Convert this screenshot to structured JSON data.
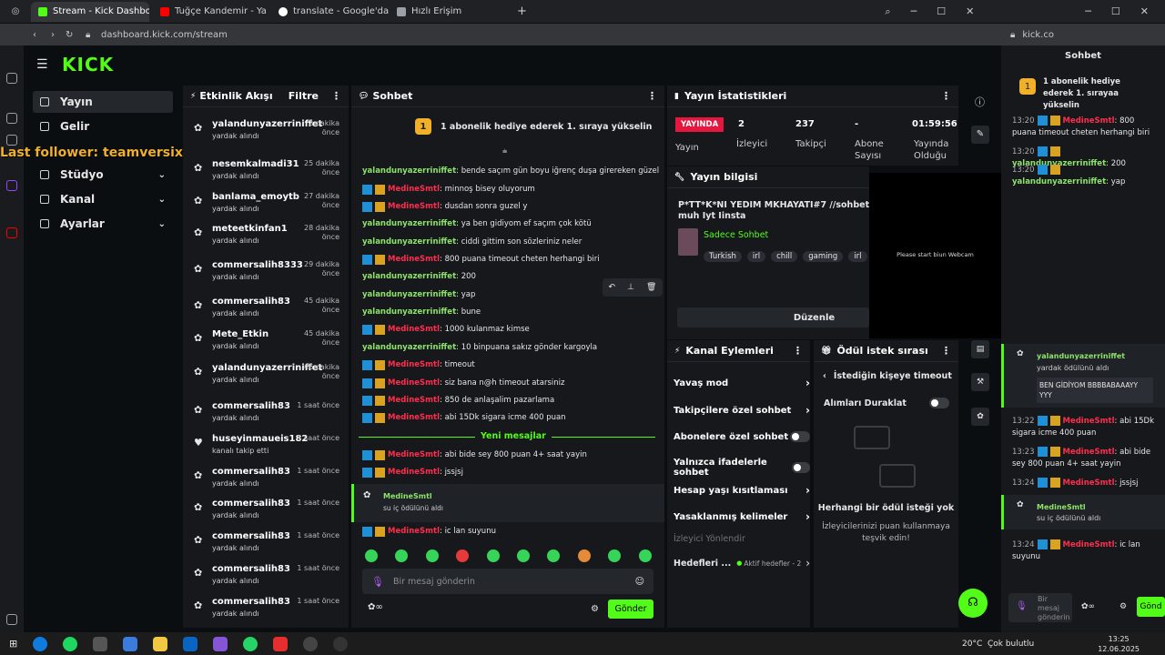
{
  "browser": {
    "tabs": [
      {
        "label": "Stream - Kick Dashboard",
        "color": "#53fc18"
      },
      {
        "label": "Tuğçe Kandemir - Ya",
        "color": "#ff0000"
      },
      {
        "label": "translate - Google'da Ara",
        "color": "#ffffff"
      },
      {
        "label": "Hızlı Erişim",
        "color": "#9aa0a6"
      }
    ],
    "url": "dashboard.kick.com/stream",
    "url2": "kick.co"
  },
  "overlay": {
    "last_follower": "Last follower: teamversix",
    "webcam": "Please start biun Webcam"
  },
  "sidenav": {
    "logo": "KICK",
    "items": [
      {
        "label": "Yayın"
      },
      {
        "label": "Gelir"
      },
      {
        "label": "Stüdyo",
        "chev": "⌄"
      },
      {
        "label": "Kanal",
        "chev": "⌄"
      },
      {
        "label": "Ayarlar",
        "chev": "⌄"
      }
    ]
  },
  "activity": {
    "title": "Etkinlik Akışı",
    "filter": "Filtre",
    "events": [
      {
        "name": "yalandunyazerriniffet",
        "sub": "yardak alındı",
        "time": "2 dakika önce"
      },
      {
        "name": "nesemkalmadi31",
        "sub": "yardak alındı",
        "time": "25 dakika önce"
      },
      {
        "name": "banlama_emoytb",
        "sub": "yardak alındı",
        "time": "27 dakika önce"
      },
      {
        "name": "meteetkinfan1",
        "sub": "yardak alındı",
        "time": "28 dakika önce"
      },
      {
        "name": "commersalih8333",
        "sub": "yardak alındı",
        "time": "29 dakika önce"
      },
      {
        "name": "commersalih83",
        "sub": "yardak alındı",
        "time": "45 dakika önce"
      },
      {
        "name": "Mete_Etkin",
        "sub": "yardak alındı",
        "time": "45 dakika önce"
      },
      {
        "name": "yalandunyazerriniffet",
        "sub": "yardak alındı",
        "time": "46 dakika önce"
      },
      {
        "name": "commersalih83",
        "sub": "yardak alındı",
        "time": "1 saat önce"
      },
      {
        "name": "huseyinmaueis182",
        "sub": "kanalı takip etti",
        "time": "1 saat önce"
      },
      {
        "name": "commersalih83",
        "sub": "yardak alındı",
        "time": "1 saat önce"
      },
      {
        "name": "commersalih83",
        "sub": "yardak alındı",
        "time": "1 saat önce"
      },
      {
        "name": "commersalih83",
        "sub": "yardak alındı",
        "time": "1 saat önce"
      },
      {
        "name": "commersalih83",
        "sub": "yardak alındı",
        "time": "1 saat önce"
      },
      {
        "name": "commersalih83",
        "sub": "yardak alındı",
        "time": "1 saat önce"
      }
    ]
  },
  "chat": {
    "title": "Sohbet",
    "banner": "1 abonelik hediye ederek 1. sıraya yükselin",
    "messages": [
      {
        "user": "yalandunyazerriniffet",
        "kind": "g",
        "text": ": bende saçım gün boyu iğrenç duşa girereken güzel"
      },
      {
        "user": "MedineSmtl",
        "kind": "r",
        "text": ": minnoş bisey oluyorum"
      },
      {
        "user": "MedineSmtl",
        "kind": "r",
        "text": ": dusdan sonra guzel y"
      },
      {
        "user": "yalandunyazerriniffet",
        "kind": "g",
        "text": ": ya ben gidiyom ef saçım çok kötü"
      },
      {
        "user": "yalandunyazerriniffet",
        "kind": "g",
        "text": ": ciddi gittim son sözleriniz neler"
      },
      {
        "user": "MedineSmtl",
        "kind": "r",
        "text": ": 800 puana timeout cheten herhangi biri"
      },
      {
        "user": "yalandunyazerriniffet",
        "kind": "g",
        "text": ": 200"
      },
      {
        "user": "yalandunyazerriniffet",
        "kind": "g",
        "text": ": yap"
      },
      {
        "user": "yalandunyazerriniffet",
        "kind": "g",
        "text": ": bune"
      },
      {
        "user": "MedineSmtl",
        "kind": "r",
        "text": ": 1000 kulanmaz kimse"
      },
      {
        "user": "yalandunyazerriniffet",
        "kind": "g",
        "text": ": 10 binpuana sakız gönder kargoyla"
      },
      {
        "user": "MedineSmtl",
        "kind": "r",
        "text": ": timeout"
      },
      {
        "user": "MedineSmtl",
        "kind": "r",
        "text": ": siz bana n@h timeout atarsiniz"
      },
      {
        "user": "MedineSmtl",
        "kind": "r",
        "text": ": 850 de anlaşalim pazarlama"
      },
      {
        "user": "MedineSmtl",
        "kind": "r",
        "text": ": abi 15Dk sigara icme 400 puan"
      }
    ],
    "new_label": "Yeni mesajlar",
    "new_messages": [
      {
        "user": "MedineSmtl",
        "kind": "r",
        "text": ": abi bide sey 800 puan 4+ saat yayin"
      },
      {
        "user": "MedineSmtl",
        "kind": "r",
        "text": ": jssjsj"
      }
    ],
    "reward": {
      "user": "MedineSmtl",
      "text": "su iç ödülünü aldı"
    },
    "last": {
      "user": "MedineSmtl",
      "kind": "r",
      "text": ": ic lan suyunu"
    },
    "placeholder": "Bir mesaj gönderin",
    "send": "Gönder"
  },
  "stats": {
    "title": "Yayın İstatistikleri",
    "live": "YAYINDA",
    "live_label": "Yayın",
    "items": [
      {
        "value": "2",
        "label": "İzleyici"
      },
      {
        "value": "237",
        "label": "Takipçi"
      },
      {
        "value": "-",
        "label": "Abone Sayısı"
      },
      {
        "value": "01:59:56",
        "label": "Yayında Olduğu"
      }
    ]
  },
  "info": {
    "title": "Yayın bilgisi",
    "stream_title": "P*TT*K*NI YEDİM MKHAYATI#7 //sohbet muh Iyt Iinsta",
    "category": "Sadece Sohbet",
    "tags": [
      "Turkish",
      "irl",
      "chill",
      "gaming",
      "irl",
      "ch"
    ],
    "edit": "Düzenle"
  },
  "actions": {
    "title": "Kanal Eylemleri",
    "items": [
      {
        "label": "Yavaş mod",
        "ctl": "›"
      },
      {
        "label": "Takipçilere özel sohbet",
        "ctl": "›"
      },
      {
        "label": "Abonelere özel sohbet",
        "ctl": "toggle"
      },
      {
        "label": "Yalnızca ifadelerle sohbet",
        "ctl": "toggle"
      },
      {
        "label": "Hesap yaşı kısıtlaması",
        "ctl": "›"
      },
      {
        "label": "Yasaklanmış kelimeler",
        "ctl": "›"
      }
    ],
    "viewer_redirect": "İzleyici Yönlendir",
    "goals": "Hedefleri ...",
    "goals_active": "Aktif hedefler - 2"
  },
  "rewards": {
    "title": "Ödül istek sırası",
    "subtitle": "İstediğin kişeye timeout",
    "pause": "Alımları Duraklat",
    "empty_title": "Herhangi bir ödül isteği yok",
    "empty_text": "İzleyicilerinizi puan kullanmaya teşvik edin!"
  },
  "rightchat": {
    "title": "Sohbet",
    "banner": "1 abonelik hediye ederek 1. sırayaa yükselin",
    "top_messages": [
      {
        "time": "13:20",
        "user": "MedineSmtl",
        "text": ": 800 puana timeout cheten herhangi biri"
      },
      {
        "time": "13:20",
        "user": "yalandunyazerriniffet",
        "text": ": 200"
      },
      {
        "time": "13:20",
        "user": "yalandunyazerriniffet",
        "text": ": yap"
      }
    ],
    "reward_user": "yalandunyazerriniffet",
    "reward_text": "yardak ödülünü aldı",
    "reward_msg": "BEN GİDİYOM BBBBABAAAYY YYY",
    "messages": [
      {
        "time": "13:22",
        "user": "MedineSmtl",
        "text": ": abi 15Dk sigara icme 400 puan"
      },
      {
        "time": "13:23",
        "user": "MedineSmtl",
        "text": ": abi bide sey 800 puan 4+ saat yayin"
      },
      {
        "time": "13:24",
        "user": "MedineSmtl",
        "text": ": jssjsj"
      }
    ],
    "reward2_user": "MedineSmtl",
    "reward2_text": "su iç ödülünü aldı",
    "last": {
      "time": "13:24",
      "user": "MedineSmtl",
      "text": ": ic lan suyunu"
    },
    "placeholder": "Bir mesaj gönderin",
    "send": "Gönd"
  },
  "taskbar": {
    "weather": "20°C  Çok bulutlu",
    "time": "13:25",
    "date": "12.06.2025"
  }
}
